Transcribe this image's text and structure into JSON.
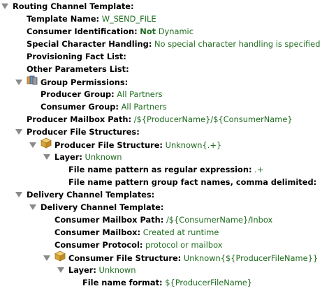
{
  "tree": {
    "routing_channel_template": {
      "label": "Routing Channel Template:"
    },
    "template_name": {
      "label": "Template Name:",
      "value": "W_SEND_FILE"
    },
    "consumer_identification": {
      "label": "Consumer Identification:",
      "value_bold": "Not",
      "value_rest": " Dynamic"
    },
    "special_character_handling": {
      "label": "Special Character Handling:",
      "value": "No special character handling is specified"
    },
    "provisioning_fact_list": {
      "label": "Provisioning Fact List:"
    },
    "other_parameters_list": {
      "label": "Other Parameters List:"
    },
    "group_permissions": {
      "label": "Group Permissions:",
      "icon": "group-permissions-icon"
    },
    "producer_group": {
      "label": "Producer Group:",
      "value": "All Partners"
    },
    "consumer_group": {
      "label": "Consumer Group:",
      "value": "All Partners"
    },
    "producer_mailbox_path": {
      "label": "Producer Mailbox Path:",
      "value": "/${ProducerName}/${ConsumerName}"
    },
    "producer_file_structures": {
      "label": "Producer File Structures:"
    },
    "producer_file_structure": {
      "label": "Producer File Structure:",
      "value": "Unknown{.+}",
      "icon": "file-structure-icon"
    },
    "layer_1": {
      "label": "Layer:",
      "value": "Unknown"
    },
    "file_name_pattern_regex": {
      "label": "File name pattern as regular expression:",
      "value": ".+"
    },
    "file_name_pattern_group": {
      "label": "File name pattern group fact names, comma delimited:"
    },
    "delivery_channel_templates": {
      "label": "Delivery Channel Templates:"
    },
    "delivery_channel_template": {
      "label": "Delivery Channel Template:"
    },
    "consumer_mailbox_path": {
      "label": "Consumer Mailbox Path:",
      "value": "/${ConsumerName}/Inbox"
    },
    "consumer_mailbox": {
      "label": "Consumer Mailbox:",
      "value": "Created at runtime"
    },
    "consumer_protocol": {
      "label": "Consumer Protocol:",
      "value": "protocol or mailbox"
    },
    "consumer_file_structure": {
      "label": "Consumer File Structure:",
      "value": "Unknown{${ProducerFileName}}",
      "icon": "file-structure-icon"
    },
    "layer_2": {
      "label": "Layer:",
      "value": "Unknown"
    },
    "file_name_format": {
      "label": "File name format:",
      "value": "${ProducerFileName}"
    }
  },
  "colors": {
    "label": "#000000",
    "value": "#1f6b1f",
    "triangle": "#8a8a8a"
  }
}
